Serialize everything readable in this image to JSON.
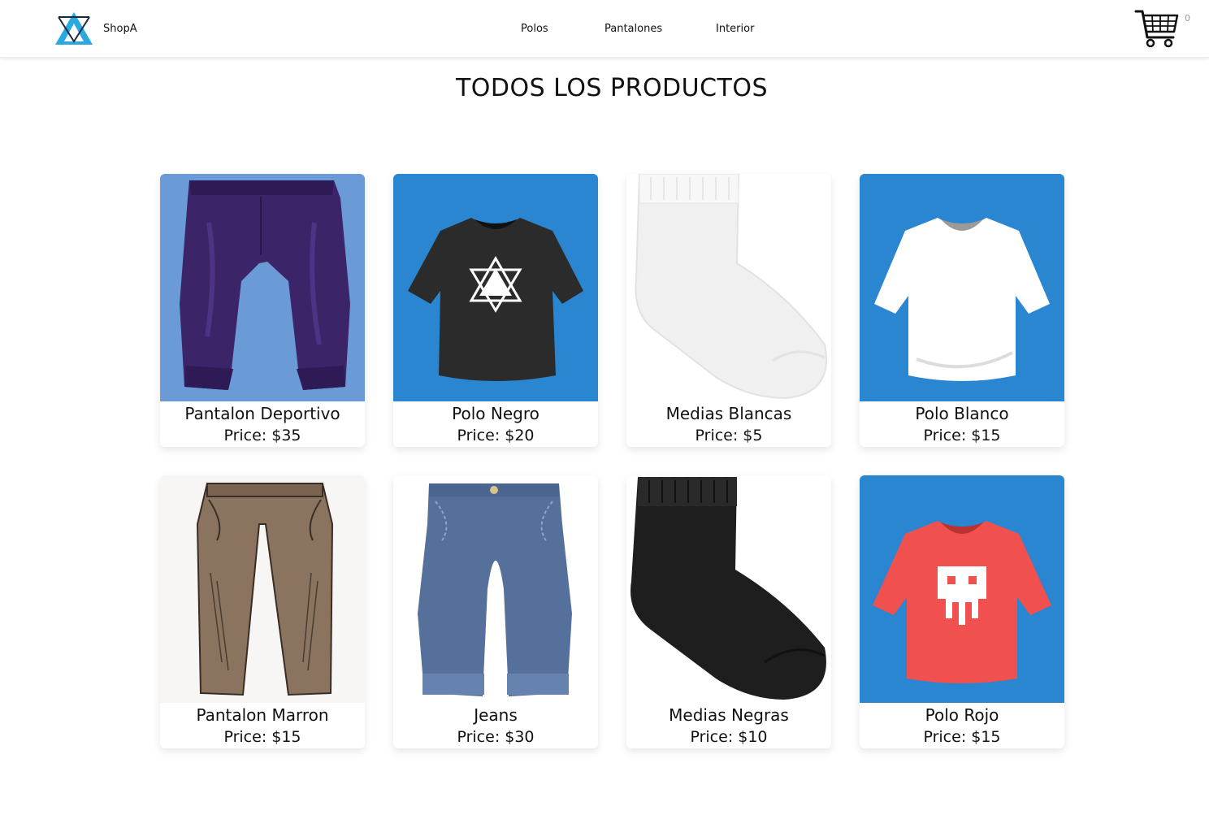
{
  "nav": {
    "brand": "ShopA",
    "links": [
      "Polos",
      "Pantalones",
      "Interior"
    ],
    "cart_count": "0",
    "cart_icon": "shopping-cart-icon",
    "logo_icon": "triangle-logo-icon"
  },
  "title": "TODOS LOS PRODUCTOS",
  "products": [
    {
      "name": "Pantalon Deportivo",
      "price": "Price: $35",
      "image": "purple-sweatpants",
      "bg": "#6a9bd6"
    },
    {
      "name": "Polo Negro",
      "price": "Price: $20",
      "image": "black-tshirt",
      "bg": "#2a86d0"
    },
    {
      "name": "Medias Blancas",
      "price": "Price: $5",
      "image": "white-sock",
      "bg": "#ffffff"
    },
    {
      "name": "Polo Blanco",
      "price": "Price: $15",
      "image": "white-tshirt",
      "bg": "#2a86d0"
    },
    {
      "name": "Pantalon Marron",
      "price": "Price: $15",
      "image": "brown-pants",
      "bg": "#f7f6f5"
    },
    {
      "name": "Jeans",
      "price": "Price: $30",
      "image": "blue-jeans",
      "bg": "#ffffff"
    },
    {
      "name": "Medias Negras",
      "price": "Price: $10",
      "image": "black-sock",
      "bg": "#ffffff"
    },
    {
      "name": "Polo Rojo",
      "price": "Price: $15",
      "image": "red-tshirt",
      "bg": "#2a86d0"
    }
  ],
  "colors": {
    "accent": "#29a9e0"
  }
}
